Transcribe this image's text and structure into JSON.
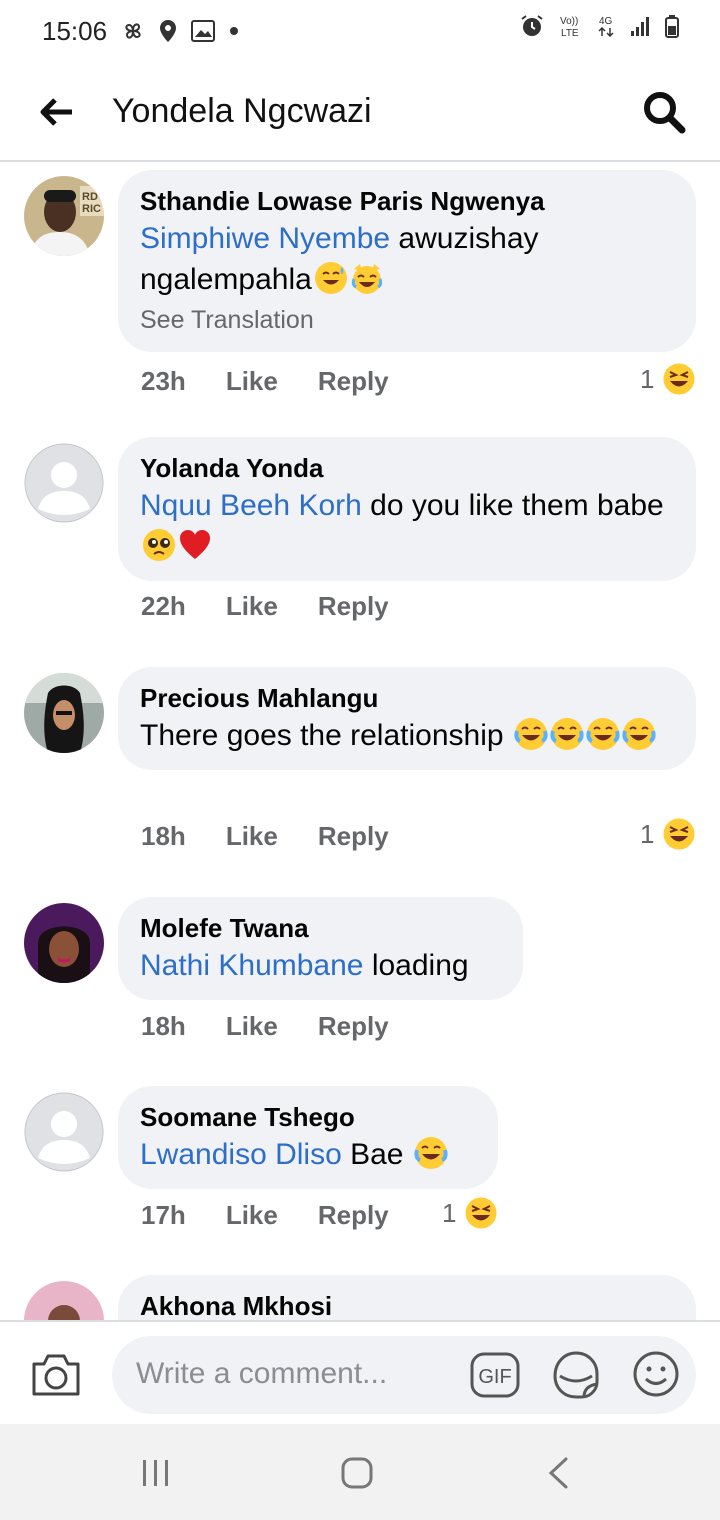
{
  "status_bar": {
    "time": "15:06",
    "network": "4G",
    "volte": "Vo)) LTE"
  },
  "header": {
    "title": "Yondela Ngcwazi"
  },
  "comments": [
    {
      "author": "Sthandie Lowase Paris Ngwenya",
      "mention": "Simphiwe Nyembe",
      "text": " awuzishay ngalempahla",
      "see_translation": "See Translation",
      "time": "23h",
      "like": "Like",
      "reply": "Reply",
      "reaction_count": "1"
    },
    {
      "author": "Yolanda Yonda",
      "mention": "Nquu Beeh Korh",
      "text": " do you like them babe ",
      "time": "22h",
      "like": "Like",
      "reply": "Reply"
    },
    {
      "author": "Precious Mahlangu",
      "text": "There goes the relationship ",
      "time": "18h",
      "like": "Like",
      "reply": "Reply",
      "reaction_count": "1"
    },
    {
      "author": "Molefe Twana",
      "mention": "Nathi Khumbane",
      "text": " loading",
      "time": "18h",
      "like": "Like",
      "reply": "Reply"
    },
    {
      "author": "Soomane Tshego",
      "mention": "Lwandiso Dliso",
      "text": " Bae ",
      "time": "17h",
      "like": "Like",
      "reply": "Reply",
      "reaction_count": "1"
    },
    {
      "author": "Akhona Mkhosi"
    }
  ],
  "composer": {
    "placeholder": "Write a comment...",
    "gif_label": "GIF"
  },
  "colors": {
    "mention": "#2d6ec9",
    "bubble": "#f0f2f5",
    "meta": "#65676b"
  }
}
